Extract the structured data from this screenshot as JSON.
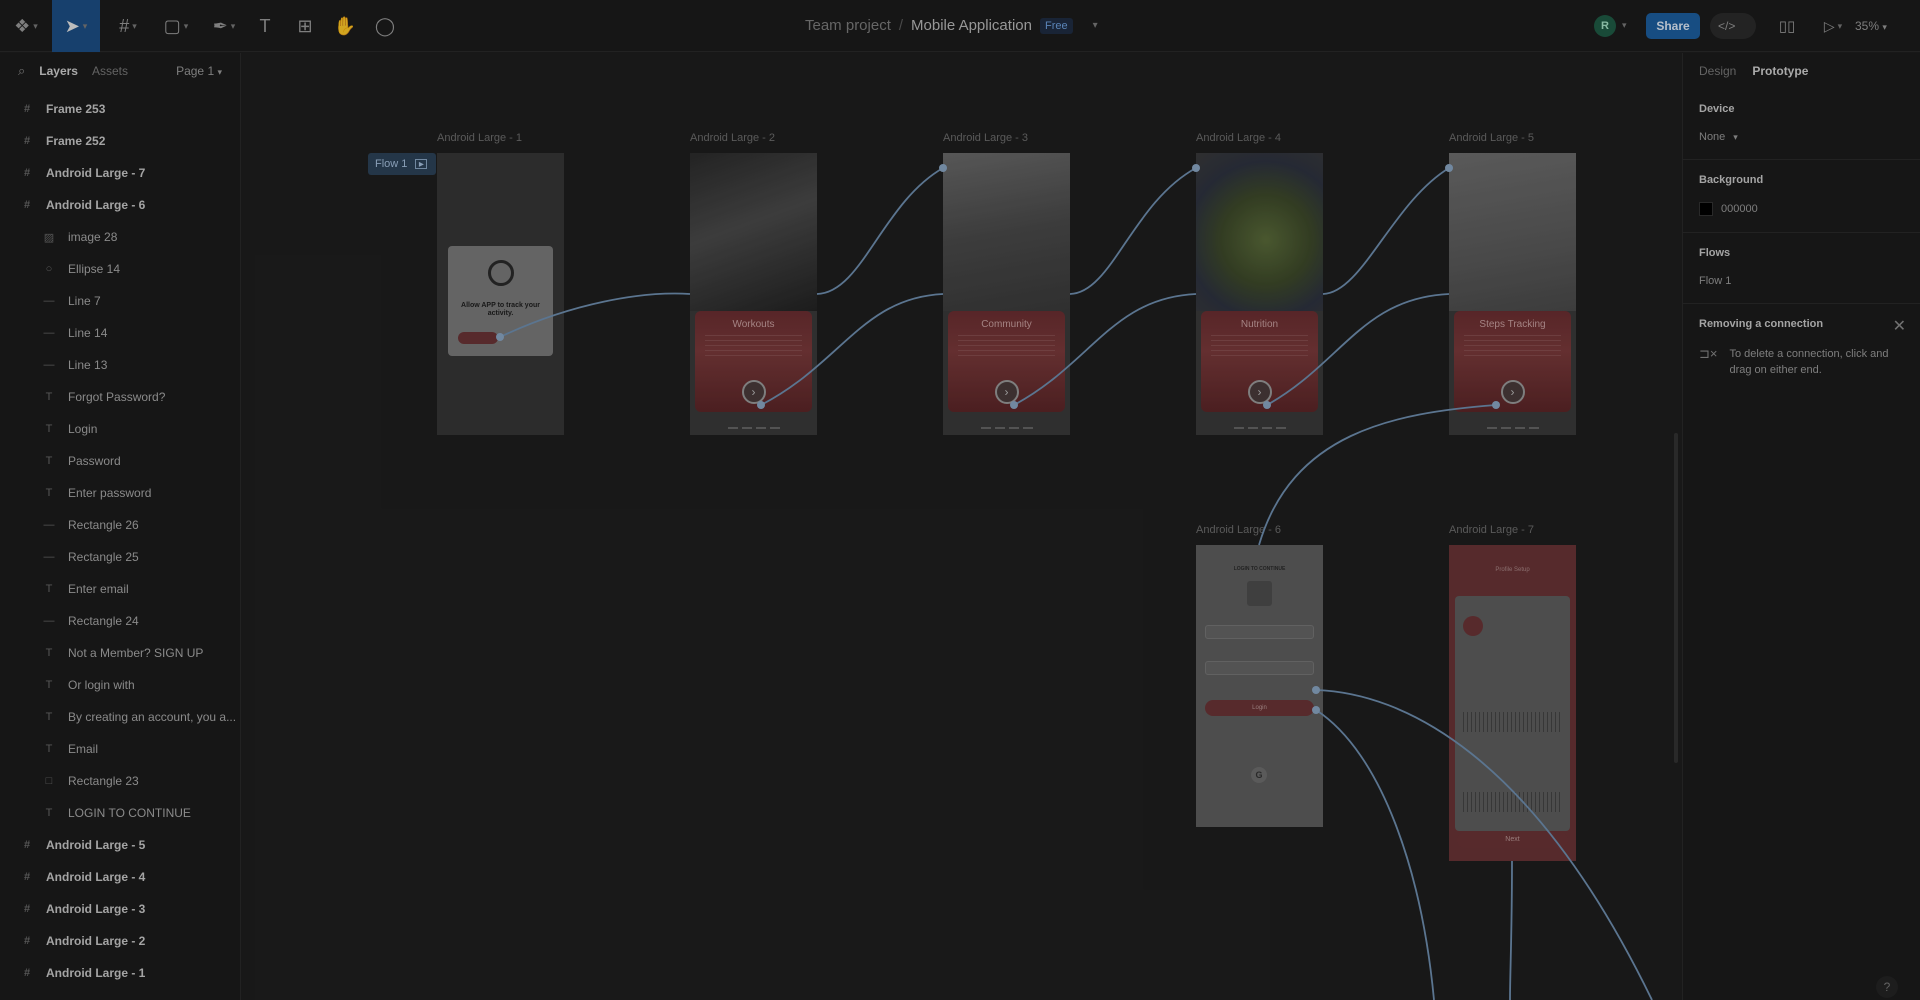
{
  "toolbar": {
    "project": "Team project",
    "separator": "/",
    "document": "Mobile Application",
    "plan_badge": "Free",
    "avatar_initial": "R",
    "share_label": "Share",
    "zoom": "35%"
  },
  "left_panel": {
    "tabs": [
      "Layers",
      "Assets"
    ],
    "page": "Page 1",
    "layers": [
      {
        "label": "Frame 253",
        "icon": "frame-icon",
        "glyph": "#",
        "kind": "top"
      },
      {
        "label": "Frame 252",
        "icon": "frame-icon",
        "glyph": "#",
        "kind": "top"
      },
      {
        "label": "Android Large - 7",
        "icon": "frame-icon",
        "glyph": "#",
        "kind": "top"
      },
      {
        "label": "Android Large - 6",
        "icon": "frame-icon",
        "glyph": "#",
        "kind": "top"
      },
      {
        "label": "image 28",
        "icon": "image-icon",
        "glyph": "▨",
        "kind": "child"
      },
      {
        "label": "Ellipse 14",
        "icon": "ellipse-icon",
        "glyph": "○",
        "kind": "child"
      },
      {
        "label": "Line 7",
        "icon": "line-icon",
        "glyph": "—",
        "kind": "child"
      },
      {
        "label": "Line 14",
        "icon": "line-icon",
        "glyph": "—",
        "kind": "child"
      },
      {
        "label": "Line 13",
        "icon": "line-icon",
        "glyph": "—",
        "kind": "child"
      },
      {
        "label": "Forgot Password?",
        "icon": "text-icon",
        "glyph": "T",
        "kind": "child"
      },
      {
        "label": "Login",
        "icon": "text-icon",
        "glyph": "T",
        "kind": "child"
      },
      {
        "label": "Password",
        "icon": "text-icon",
        "glyph": "T",
        "kind": "child"
      },
      {
        "label": "Enter password",
        "icon": "text-icon",
        "glyph": "T",
        "kind": "child"
      },
      {
        "label": "Rectangle 26",
        "icon": "rectangle-icon",
        "glyph": "—",
        "kind": "child"
      },
      {
        "label": "Rectangle 25",
        "icon": "rectangle-icon",
        "glyph": "—",
        "kind": "child"
      },
      {
        "label": "Enter email",
        "icon": "text-icon",
        "glyph": "T",
        "kind": "child"
      },
      {
        "label": "Rectangle 24",
        "icon": "rectangle-icon",
        "glyph": "—",
        "kind": "child"
      },
      {
        "label": "Not a Member? SIGN UP",
        "icon": "text-icon",
        "glyph": "T",
        "kind": "child"
      },
      {
        "label": "Or login with",
        "icon": "text-icon",
        "glyph": "T",
        "kind": "child"
      },
      {
        "label": "By creating an account, you a...",
        "icon": "text-icon",
        "glyph": "T",
        "kind": "child"
      },
      {
        "label": "Email",
        "icon": "text-icon",
        "glyph": "T",
        "kind": "child"
      },
      {
        "label": "Rectangle 23",
        "icon": "rectangle-icon",
        "glyph": "□",
        "kind": "child"
      },
      {
        "label": "LOGIN TO CONTINUE",
        "icon": "text-icon",
        "glyph": "T",
        "kind": "child"
      },
      {
        "label": "Android Large - 5",
        "icon": "frame-icon",
        "glyph": "#",
        "kind": "top"
      },
      {
        "label": "Android Large - 4",
        "icon": "frame-icon",
        "glyph": "#",
        "kind": "top"
      },
      {
        "label": "Android Large - 3",
        "icon": "frame-icon",
        "glyph": "#",
        "kind": "top"
      },
      {
        "label": "Android Large - 2",
        "icon": "frame-icon",
        "glyph": "#",
        "kind": "top"
      },
      {
        "label": "Android Large - 1",
        "icon": "frame-icon",
        "glyph": "#",
        "kind": "top"
      }
    ]
  },
  "right_panel": {
    "tabs": [
      "Design",
      "Prototype"
    ],
    "device_title": "Device",
    "device_value": "None",
    "background_title": "Background",
    "background_value": "000000",
    "background_color": "#000000",
    "flows_title": "Flows",
    "flow_item": "Flow 1",
    "removing_title": "Removing a connection",
    "removing_hint": "To delete a connection, click and drag on either end."
  },
  "canvas": {
    "flow_badge": "Flow 1",
    "frames": [
      {
        "label": "Android Large - 1",
        "text": "Allow APP to track your activity."
      },
      {
        "label": "Android Large - 2",
        "title": "Workouts"
      },
      {
        "label": "Android Large - 3",
        "title": "Community"
      },
      {
        "label": "Android Large - 4",
        "title": "Nutrition"
      },
      {
        "label": "Android Large - 5",
        "title": "Steps Tracking"
      },
      {
        "label": "Android Large - 6",
        "heading": "LOGIN TO CONTINUE",
        "login": "Login"
      },
      {
        "label": "Android Large - 7",
        "heading": "Profile Setup",
        "next": "Next"
      }
    ]
  },
  "colors": {
    "accent": "#1d5f9f",
    "connector": "#6f8fb0",
    "card": "#7a3a3b"
  }
}
